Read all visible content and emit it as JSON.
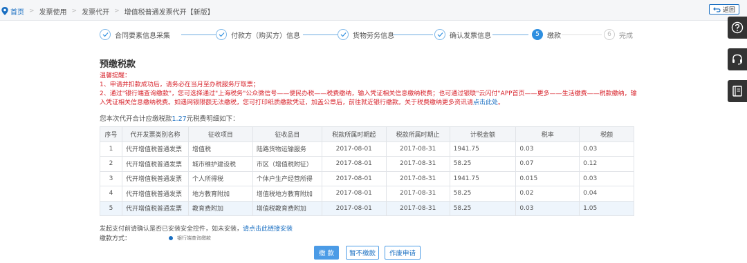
{
  "breadcrumb": [
    "首页",
    "发票使用",
    "发票代开",
    "增值税普通发票代开【新版】"
  ],
  "back_label": "返回",
  "side_tools": [
    "help-icon",
    "headset-icon",
    "book-icon"
  ],
  "steps": [
    {
      "num": "1",
      "label": "合同要素信息采集",
      "state": "done"
    },
    {
      "num": "2",
      "label": "付款方（购买方）信息",
      "state": "done"
    },
    {
      "num": "3",
      "label": "货物劳务信息",
      "state": "done"
    },
    {
      "num": "4",
      "label": "确认发票信息",
      "state": "done"
    },
    {
      "num": "5",
      "label": "缴款",
      "state": "active"
    },
    {
      "num": "6",
      "label": "完成",
      "state": "todo"
    }
  ],
  "page_title": "预缴税款",
  "notice": {
    "heading": "温馨提醒：",
    "line1": "1、申请并扣款成功后，请务必在当月至办税服务厅取票；",
    "line2": "2、通过\"银行端查询缴款\"，您可选择通过\"上海税务\"公众微信号——便民办税——税费缴纳，输入凭证相关信息缴纳税费；也可通过银联\"云闪付\"APP首页——更多——生活缴费——税款缴纳，输入凭证相关信息缴纳税费。如遇网银限额无法缴税，您可打印纸质缴款凭证，加盖公章后，前往就近银行缴款。关于税费缴纳更多资讯请",
    "link": "点击此处",
    "tail": "。"
  },
  "summary": {
    "prefix": "您本次代开合计应缴税款",
    "amount": "1.27",
    "suffix": "元税费明细如下："
  },
  "table": {
    "headers": [
      "序号",
      "代开发票类别名称",
      "征收项目",
      "征收品目",
      "税款所属时期起",
      "税款所属时期止",
      "计税金额",
      "税率",
      "税额"
    ],
    "rows": [
      [
        "1",
        "代开增值税普通发票",
        "增值税",
        "陆路货物运输服务",
        "2017-08-01",
        "2017-08-31",
        "1941.75",
        "0.03",
        "0.03"
      ],
      [
        "2",
        "代开增值税普通发票",
        "城市维护建设税",
        "市区（增值税附征）",
        "2017-08-01",
        "2017-08-31",
        "58.25",
        "0.07",
        "0.12"
      ],
      [
        "3",
        "代开增值税普通发票",
        "个人所得税",
        "个体户生产经营所得",
        "2017-08-01",
        "2017-08-31",
        "1941.75",
        "0.015",
        "0.03"
      ],
      [
        "4",
        "代开增值税普通发票",
        "地方教育附加",
        "增值税地方教育附加",
        "2017-08-01",
        "2017-08-31",
        "58.25",
        "0.02",
        "0.04"
      ],
      [
        "5",
        "代开增值税普通发票",
        "教育费附加",
        "增值税教育费附加",
        "2017-08-01",
        "2017-08-31",
        "58.25",
        "0.03",
        "1.05"
      ]
    ]
  },
  "hint": {
    "text": "发起支付前请确认是否已安装安全控件，如未安装，",
    "link": "请点击此链接安装"
  },
  "pay_method": {
    "label": "缴款方式：",
    "option": "银行端查询缴款"
  },
  "buttons": {
    "pay": "缴 款",
    "later": "暂不缴款",
    "cancel": "作废申请"
  },
  "colors": {
    "accent": "#1a6fc2",
    "warn": "#d8262e",
    "primary_btn": "#4b9be6"
  }
}
